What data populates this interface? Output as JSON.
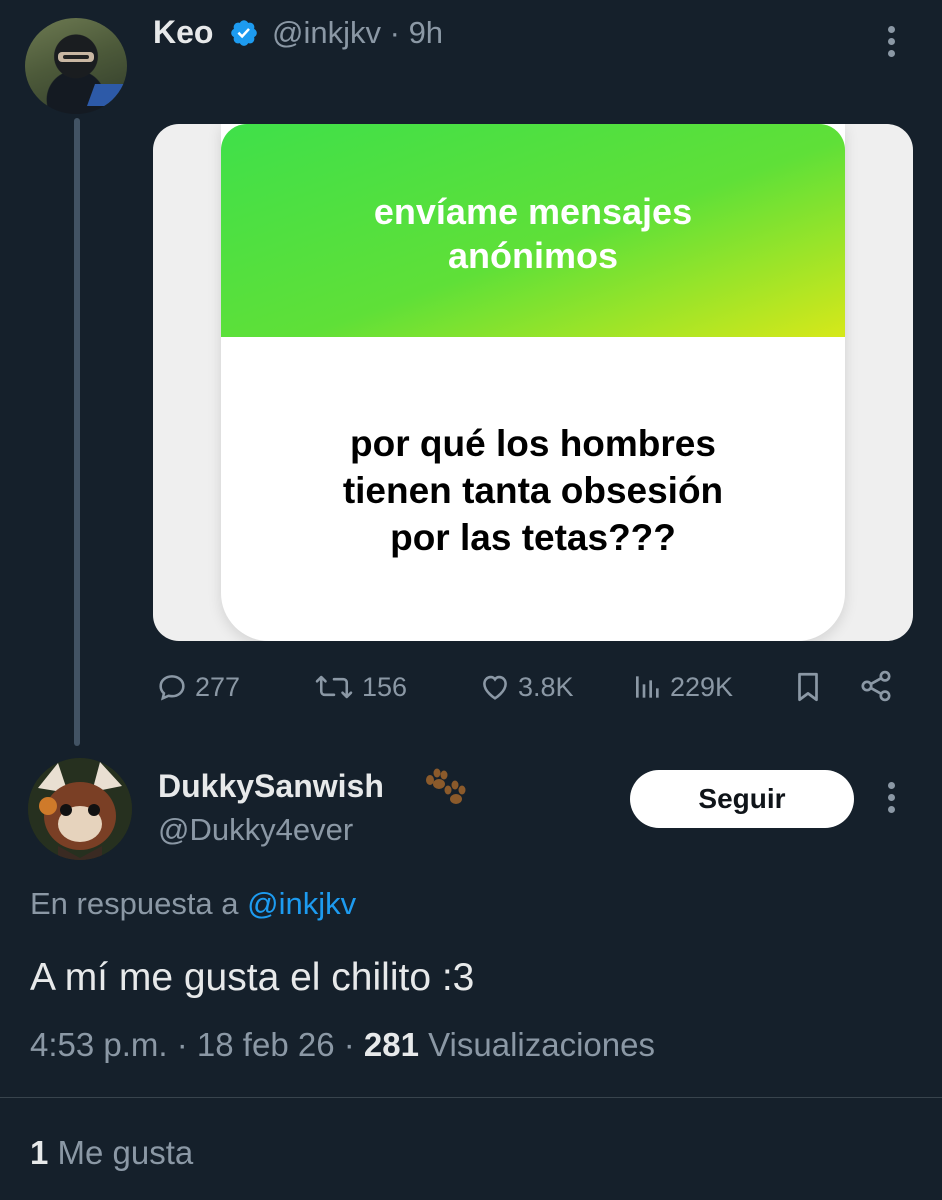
{
  "parent_tweet": {
    "author_name": "Keo",
    "handle": "@inkjkv",
    "separator": "·",
    "time": "9h",
    "image": {
      "banner_title_line1": "envíame mensajes",
      "banner_title_line2": "anónimos",
      "question_line1": "por qué los hombres",
      "question_line2": "tienen tanta obsesión",
      "question_line3": "por las tetas???"
    },
    "actions": {
      "replies": "277",
      "retweets": "156",
      "likes": "3.8K",
      "views": "229K"
    }
  },
  "reply_tweet": {
    "author_name": "DukkySanwish",
    "handle": "@Dukky4ever",
    "follow_label": "Seguir",
    "reply_prefix": "En respuesta a",
    "reply_mention": "@inkjkv",
    "text": "A mí me gusta el chilito :3",
    "time": "4:53 p.m.",
    "date": "18 feb 26",
    "separator": "·",
    "views_count": "281",
    "views_label": "Visualizaciones",
    "likes_count": "1",
    "likes_label": "Me gusta"
  },
  "colors": {
    "background": "#15202b",
    "secondary_text": "#8b98a5",
    "accent": "#1d9bf0",
    "banner_green": "#3fe04a"
  },
  "icons": [
    "verified-badge-icon",
    "more-options-icon",
    "reply-icon",
    "retweet-icon",
    "like-icon",
    "views-icon",
    "bookmark-icon",
    "share-icon",
    "paw-emoji-icon"
  ]
}
